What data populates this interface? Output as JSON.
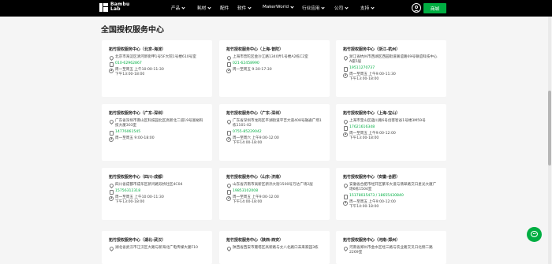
{
  "nav": {
    "logo_line1": "Bambu",
    "logo_line2": "Lab",
    "items": [
      {
        "label": "产品",
        "has_dropdown": true
      },
      {
        "label": "耗材",
        "has_dropdown": true
      },
      {
        "label": "配件",
        "has_dropdown": false
      },
      {
        "label": "软件",
        "has_dropdown": true
      },
      {
        "label": "MakerWorld",
        "has_dropdown": true
      },
      {
        "label": "行业应用",
        "has_dropdown": true
      },
      {
        "label": "公司",
        "has_dropdown": true
      },
      {
        "label": "支持",
        "has_dropdown": true
      }
    ],
    "shop_label": "商城"
  },
  "page_title": "全国授权服务中心",
  "centers": [
    {
      "title": "拓竹授权服务中心（北京-海淀）",
      "address": "北京市海淀区清河新街甲1号5F大院1号楼610号室",
      "phone": "010-62962867",
      "hours": [
        "周一至周五 上午10:00-11:30",
        "下午13:00-18:00"
      ]
    },
    {
      "title": "拓竹授权服务中心（上海-普陀）",
      "address": "上海市普陀区金沙江路1340弄1号楼A2栋C2室",
      "phone": "021-62458990",
      "hours": [
        "周一至周五 9:30-17:30"
      ]
    },
    {
      "title": "拓竹授权服务中心（浙江-杭州）",
      "address": "浙江省杭州市西湖区西园街道联谊路69号联谊科技中心A座5层",
      "phone": "19511270737",
      "hours": [
        "周一至周五 上午9:00-11:30",
        "下午13:00-18:00"
      ]
    },
    {
      "title": "拓竹授权服务中心（广东-深圳）",
      "address": "广东省深圳市南山区科技园北区高新北二道19号富裕科技大厦303室",
      "phone": "14776061545",
      "hours": [
        "周一至周五 9:00-18:00"
      ]
    },
    {
      "title": "拓竹授权服务中心（广东-深圳）",
      "address": "广东省深圳市龙岗区平湖街道平吉大道408号融通广场1栋1101-02",
      "phone": "0755-85229042",
      "hours": [
        "周一至周六 上午9:00-12:00",
        "下午14:00-18:00"
      ]
    },
    {
      "title": "拓竹授权服务中心（上海-宝山）",
      "address": "上海市宝山区蕴川路6号创客智谷1号楼3M59号",
      "phone": "17621616348",
      "hours": [
        "周一至周五 上午9:00-12:00",
        "下午13:00-18:00"
      ]
    },
    {
      "title": "拓竹授权服务中心（四川-成都）",
      "address": "四川省成都市成华区新鸿路双桥社区4C04",
      "phone": "15756312318",
      "hours": [
        "周一至周五 上午10:00-11:30",
        "下午13:00-18:00"
      ]
    },
    {
      "title": "拓竹授权服务中心（山东-济南）",
      "address": "山东省济南市高新区新泺大街1500号万达广场2层",
      "phone": "19853102008",
      "hours": [
        "周一至周五 上午9:00-12:00",
        "下午14:00-18:00"
      ]
    },
    {
      "title": "拓竹授权服务中心（安徽-合肥）",
      "address": "安徽省合肥市经开区繁华大道与翡翠路交口星光大厦广场6栋1504室",
      "phone": "15178035473 / 18655430840",
      "hours": [
        "周一至周五 上午9:00-12:00",
        "下午14:00-18:00"
      ]
    },
    {
      "title": "拓竹授权服务中心（湖北-武汉）",
      "address": "湖北省武汉市江汉区大路与新海北广电传媒大厦F10",
      "phone": "",
      "hours": []
    },
    {
      "title": "拓竹授权服务中心（陕西-西安）",
      "address": "陕西省西安市雁塔区高新路与丈八北路口未来家园3栋",
      "phone": "",
      "hours": []
    },
    {
      "title": "拓竹授权服务中心（河南-郑州）",
      "address": "河南省郑州市金水区经三路与农业路交叉口北侧二路2269室",
      "phone": "",
      "hours": []
    }
  ]
}
